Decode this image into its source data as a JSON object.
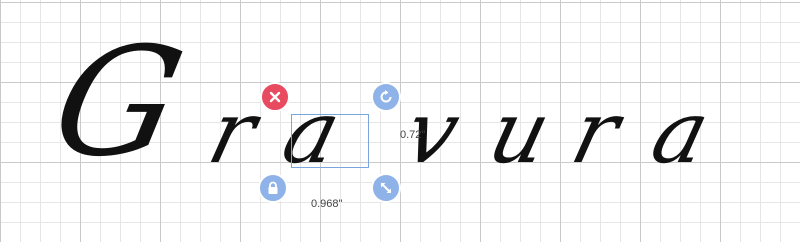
{
  "design": {
    "letters": [
      "G",
      "r",
      "a",
      "v",
      "u",
      "r",
      "a"
    ]
  },
  "selection": {
    "width_label": "0.968\"",
    "height_label": "0.72\""
  },
  "handles": {
    "delete_icon": "close-icon",
    "rotate_icon": "rotate-icon",
    "lock_icon": "lock-icon",
    "resize_icon": "resize-icon"
  },
  "colors": {
    "grid_major": "#c9c9c9",
    "grid_minor": "#e6e6e6",
    "ink": "#111111",
    "delete": "#e84a5f",
    "handle": "#8fb3e8",
    "selection_border": "#7aa6e0"
  }
}
